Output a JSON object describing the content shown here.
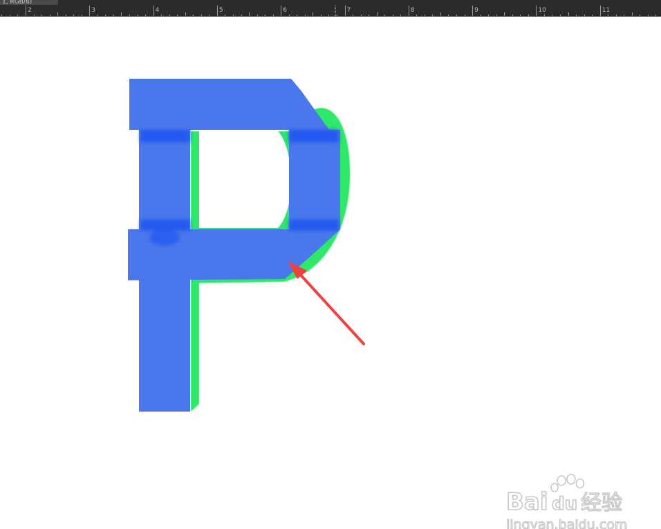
{
  "window": {
    "doc_tab_text": "1, RGB/8)"
  },
  "ruler": {
    "unit": "inches",
    "labels": [
      "2",
      "3",
      "4",
      "5",
      "6",
      "7",
      "8",
      "9",
      "10",
      "11"
    ]
  },
  "canvas": {
    "background": "#ffffff",
    "letter": {
      "glyph": "P",
      "fill_color": "#4a78ec",
      "shadow_color": "#2ee86a",
      "seam_color": "#1f55f0"
    },
    "annotation": {
      "type": "arrow",
      "color": "#f04040",
      "icon": "red-arrow-icon"
    }
  },
  "watermark": {
    "brand": "Bai",
    "brand_suffix": "du",
    "brand_cn": "经验",
    "url": "jingyan.baidu.com",
    "icon": "paw-icon"
  }
}
